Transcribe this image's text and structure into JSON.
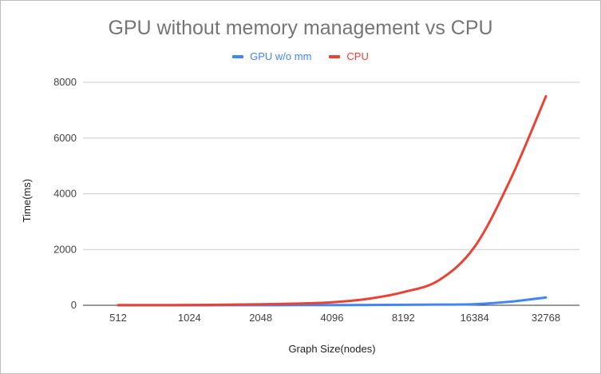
{
  "chart_data": {
    "type": "line",
    "title": "GPU without memory management vs CPU",
    "xlabel": "Graph Size(nodes)",
    "ylabel": "Time(ms)",
    "categories": [
      "512",
      "1024",
      "2048",
      "4096",
      "8192",
      "16384",
      "32768"
    ],
    "x_tick_labels": [
      "512",
      "1024",
      "2048",
      "4096",
      "8192",
      "16384",
      "32768"
    ],
    "y_ticks": [
      0,
      2000,
      4000,
      6000,
      8000
    ],
    "ylim": [
      0,
      8000
    ],
    "grid": true,
    "legend": "top-center",
    "series": [
      {
        "name": "GPU w/o mm",
        "color": "#4285f4",
        "points": [
          [
            0,
            0
          ],
          [
            0.5,
            0
          ],
          [
            1,
            1
          ],
          [
            1.5,
            2
          ],
          [
            2,
            3
          ],
          [
            2.5,
            5
          ],
          [
            3,
            7
          ],
          [
            3.5,
            11
          ],
          [
            4,
            16
          ],
          [
            4.5,
            25
          ],
          [
            5,
            40
          ],
          [
            5.5,
            130
          ],
          [
            6,
            280
          ]
        ]
      },
      {
        "name": "CPU",
        "color": "#ea4335",
        "points": [
          [
            0,
            5
          ],
          [
            0.5,
            8
          ],
          [
            1,
            12
          ],
          [
            1.5,
            20
          ],
          [
            2,
            35
          ],
          [
            2.5,
            60
          ],
          [
            3,
            110
          ],
          [
            3.5,
            230
          ],
          [
            4,
            470
          ],
          [
            4.5,
            900
          ],
          [
            5,
            2100
          ],
          [
            5.5,
            4500
          ],
          [
            6,
            7500
          ]
        ]
      }
    ]
  }
}
